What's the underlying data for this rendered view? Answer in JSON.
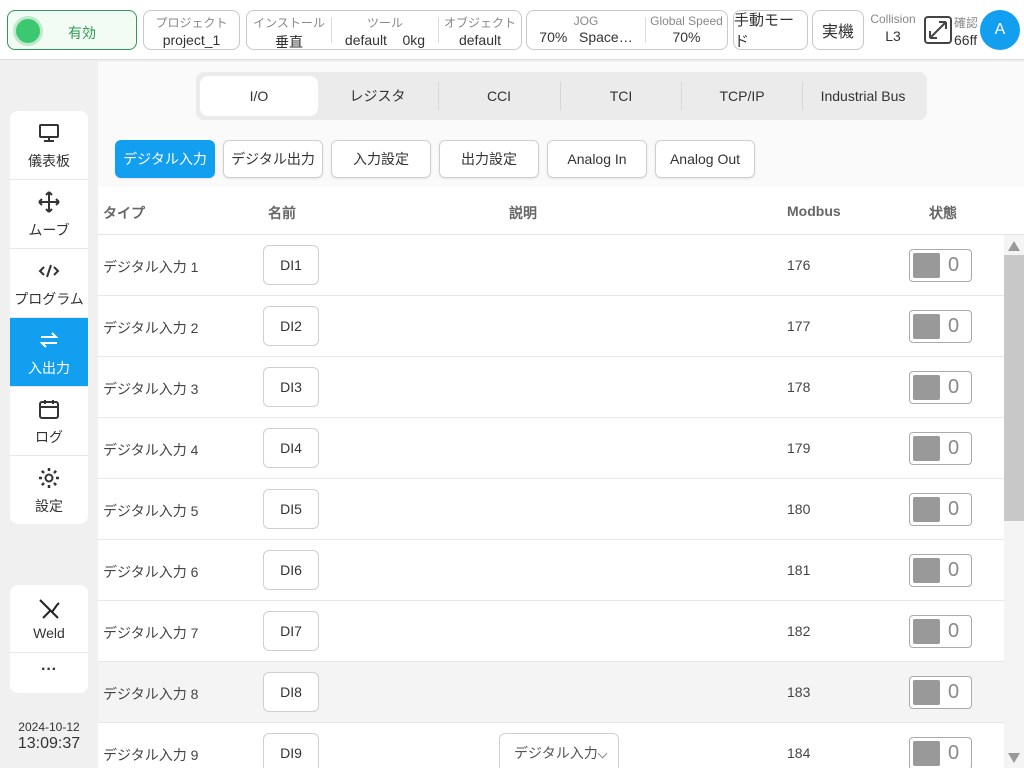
{
  "topbar": {
    "status": "有効",
    "project_label": "プロジェクト",
    "project_value": "project_1",
    "install_label": "インストール",
    "install_value": "垂直",
    "tool_label": "ツール",
    "tool_value": "default",
    "tool_weight": "0kg",
    "object_label": "オブジェクト",
    "object_value": "default",
    "jog_label": "JOG",
    "jog_value": "70%",
    "jog_space": "Space…",
    "speed_label": "Global Speed",
    "speed_value": "70%",
    "manual_mode": "手動モード",
    "real_machine": "実機",
    "collision_label": "Collision",
    "collision_value": "L3",
    "confirm_label": "確認",
    "confirm_value": "66ff",
    "avatar": "A"
  },
  "sidebar": {
    "items": [
      {
        "label": "儀表板",
        "icon": "monitor-icon"
      },
      {
        "label": "ムーブ",
        "icon": "move-arrows-icon"
      },
      {
        "label": "プログラム",
        "icon": "code-icon"
      },
      {
        "label": "入出力",
        "icon": "swap-arrows-icon"
      },
      {
        "label": "ログ",
        "icon": "calendar-icon"
      },
      {
        "label": "設定",
        "icon": "gear-icon"
      }
    ],
    "weld_label": "Weld",
    "more_label": "···"
  },
  "clock": {
    "date": "2024-10-12",
    "time": "13:09:37"
  },
  "tabs": [
    "I/O",
    "レジスタ",
    "CCI",
    "TCI",
    "TCP/IP",
    "Industrial Bus"
  ],
  "subtabs": [
    "デジタル入力",
    "デジタル出力",
    "入力設定",
    "出力設定",
    "Analog In",
    "Analog Out"
  ],
  "table": {
    "headers": {
      "type": "タイプ",
      "name": "名前",
      "desc": "説明",
      "modbus": "Modbus",
      "state": "状態"
    },
    "rows": [
      {
        "type": "デジタル入力 1",
        "name": "DI1",
        "modbus": "176",
        "state": "0"
      },
      {
        "type": "デジタル入力 2",
        "name": "DI2",
        "modbus": "177",
        "state": "0"
      },
      {
        "type": "デジタル入力 3",
        "name": "DI3",
        "modbus": "178",
        "state": "0"
      },
      {
        "type": "デジタル入力 4",
        "name": "DI4",
        "modbus": "179",
        "state": "0"
      },
      {
        "type": "デジタル入力 5",
        "name": "DI5",
        "modbus": "180",
        "state": "0"
      },
      {
        "type": "デジタル入力 6",
        "name": "DI6",
        "modbus": "181",
        "state": "0"
      },
      {
        "type": "デジタル入力 7",
        "name": "DI7",
        "modbus": "182",
        "state": "0"
      },
      {
        "type": "デジタル入力 8",
        "name": "DI8",
        "modbus": "183",
        "state": "0"
      },
      {
        "type": "デジタル入力 9",
        "name": "DI9",
        "modbus": "184",
        "state": "0",
        "desc": "デジタル入力"
      }
    ]
  },
  "colors": {
    "accent": "#139ff0",
    "status_green": "#3cc870"
  }
}
